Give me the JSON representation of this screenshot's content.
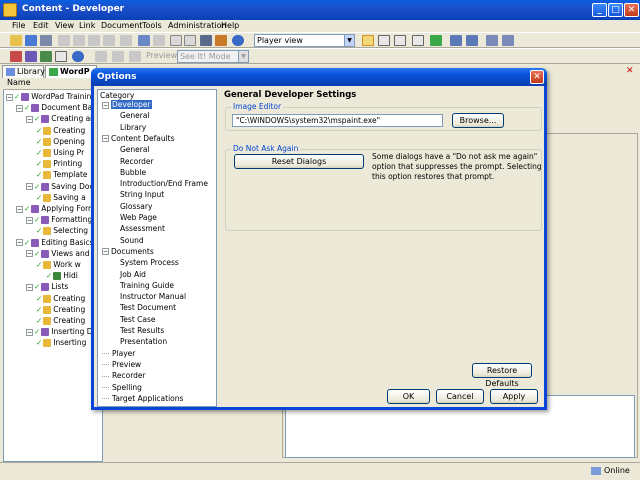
{
  "window": {
    "title": "Content - Developer",
    "minimize": "_",
    "maximize": "□",
    "close": "✕"
  },
  "menu": [
    "File",
    "Edit",
    "View",
    "Link",
    "Document",
    "Tools",
    "Administration",
    "Help"
  ],
  "toolbar": {
    "view_select": "Player view",
    "preview_label": "Preview:",
    "mode_select": "See It! Mode"
  },
  "tabs": {
    "library": "Library",
    "wordpad": "WordP"
  },
  "left": {
    "column_header": "Name",
    "tree": [
      {
        "label": "WordPad Training",
        "level": 0
      },
      {
        "label": "Document Basic",
        "level": 1
      },
      {
        "label": "Creating an",
        "level": 2
      },
      {
        "label": "Creating",
        "level": 3
      },
      {
        "label": "Opening",
        "level": 3
      },
      {
        "label": "Using Pr",
        "level": 3
      },
      {
        "label": "Printing",
        "level": 3
      },
      {
        "label": "Template",
        "level": 3
      },
      {
        "label": "Saving Doc",
        "level": 2
      },
      {
        "label": "Saving a",
        "level": 3
      },
      {
        "label": "Applying Forma",
        "level": 1
      },
      {
        "label": "Formatting",
        "level": 2
      },
      {
        "label": "Selecting",
        "level": 3
      },
      {
        "label": "Editing Basics",
        "level": 1
      },
      {
        "label": "Views and T",
        "level": 2
      },
      {
        "label": "Work w",
        "level": 3
      },
      {
        "label": "Hidi",
        "level": 4
      },
      {
        "label": "Lists",
        "level": 2
      },
      {
        "label": "Creating",
        "level": 3
      },
      {
        "label": "Creating",
        "level": 3
      },
      {
        "label": "Creating",
        "level": 3
      },
      {
        "label": "Inserting Da",
        "level": 2
      },
      {
        "label": "Inserting",
        "level": 3
      }
    ]
  },
  "status": {
    "online": "Online"
  },
  "dialog": {
    "title": "Options",
    "close": "✕",
    "category_label": "Category",
    "categories": [
      {
        "label": "Developer",
        "level": 0,
        "expander": "−",
        "selected": true
      },
      {
        "label": "General",
        "level": 1
      },
      {
        "label": "Library",
        "level": 1
      },
      {
        "label": "Content Defaults",
        "level": 0,
        "expander": "−"
      },
      {
        "label": "General",
        "level": 1
      },
      {
        "label": "Recorder",
        "level": 1
      },
      {
        "label": "Bubble",
        "level": 1
      },
      {
        "label": "Introduction/End Frame",
        "level": 1
      },
      {
        "label": "String Input",
        "level": 1
      },
      {
        "label": "Glossary",
        "level": 1
      },
      {
        "label": "Web Page",
        "level": 1
      },
      {
        "label": "Assessment",
        "level": 1
      },
      {
        "label": "Sound",
        "level": 1
      },
      {
        "label": "Documents",
        "level": 0,
        "expander": "−"
      },
      {
        "label": "System Process",
        "level": 1
      },
      {
        "label": "Job Aid",
        "level": 1
      },
      {
        "label": "Training Guide",
        "level": 1
      },
      {
        "label": "Instructor Manual",
        "level": 1
      },
      {
        "label": "Test Document",
        "level": 1
      },
      {
        "label": "Test Case",
        "level": 1
      },
      {
        "label": "Test Results",
        "level": 1
      },
      {
        "label": "Presentation",
        "level": 1
      },
      {
        "label": "Player",
        "level": 0
      },
      {
        "label": "Preview",
        "level": 0
      },
      {
        "label": "Recorder",
        "level": 0
      },
      {
        "label": "Spelling",
        "level": 0
      },
      {
        "label": "Target Applications",
        "level": 0
      }
    ],
    "settings_title": "General Developer Settings",
    "image_editor": {
      "label": "Image Editor",
      "value": "\"C:\\WINDOWS\\system32\\mspaint.exe\"",
      "browse": "Browse..."
    },
    "do_not_ask": {
      "label": "Do Not Ask Again",
      "reset": "Reset Dialogs",
      "hint_lines": [
        "Some dialogs have a \"Do not ask me again\"",
        "option that suppresses the prompt. Selecting",
        "this option restores that prompt."
      ]
    },
    "restore_defaults": "Restore Defaults",
    "ok": "OK",
    "cancel": "Cancel",
    "apply": "Apply"
  }
}
